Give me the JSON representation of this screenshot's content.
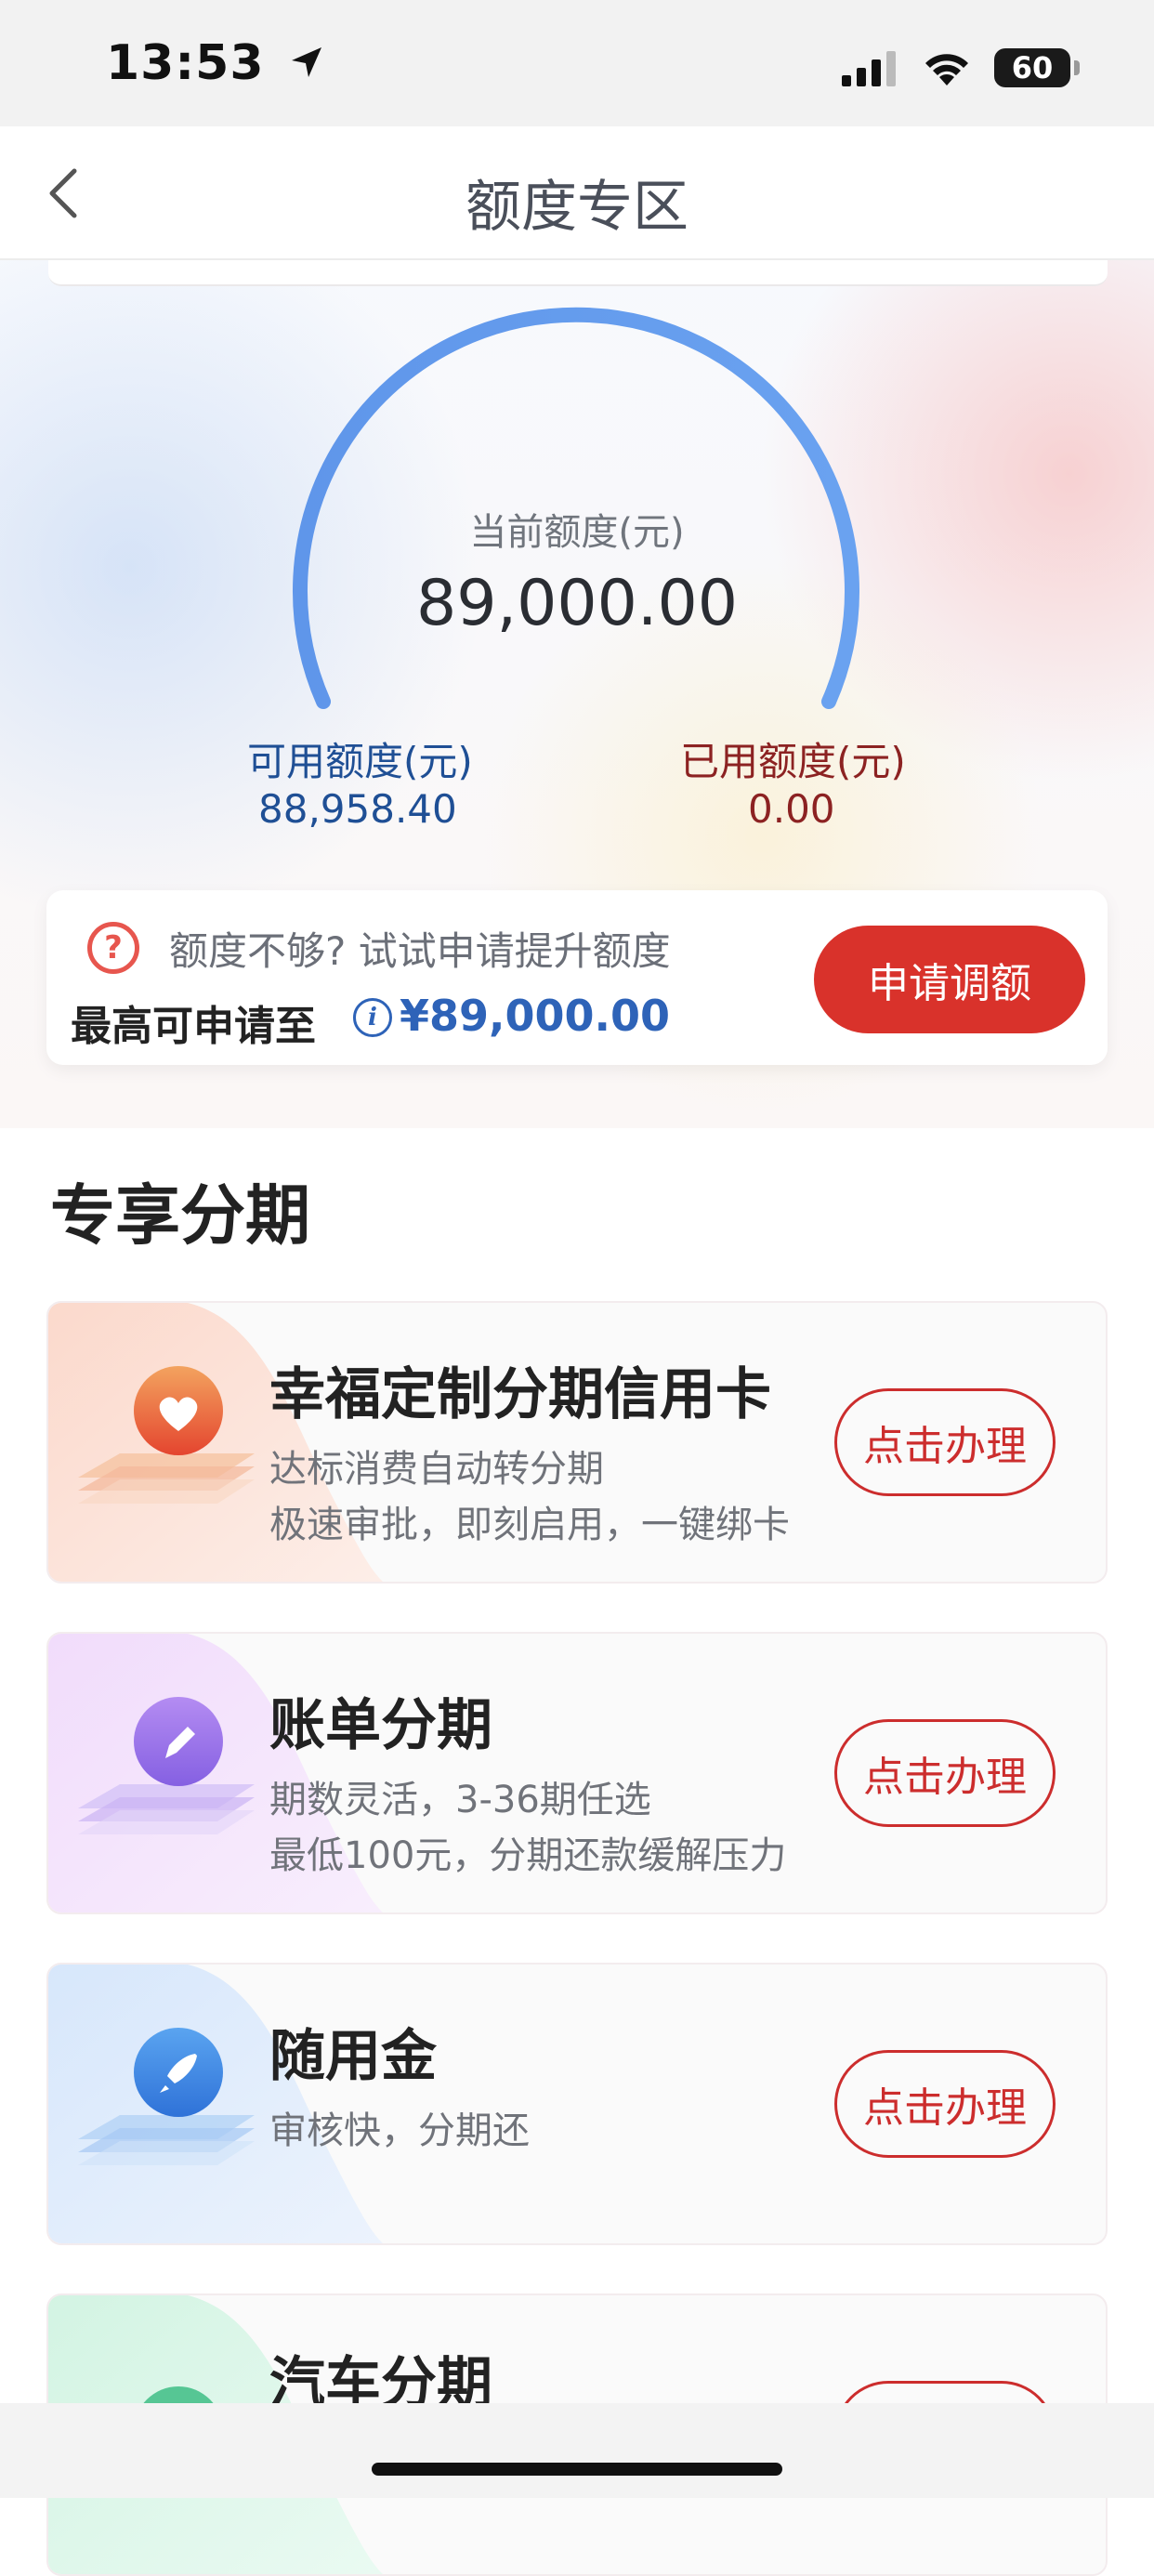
{
  "status": {
    "time": "13:53",
    "battery": "60"
  },
  "nav": {
    "title": "额度专区"
  },
  "limit": {
    "current_label": "当前额度(元)",
    "current_value": "89,000.00",
    "available_label": "可用额度(元)",
    "available_value": "88,958.40",
    "used_label": "已用额度(元)",
    "used_value": "0.00"
  },
  "upgrade": {
    "prompt": "额度不够? 试试申请提升额度",
    "max_label": "最高可申请至",
    "max_value": "¥89,000.00",
    "button": "申请调额"
  },
  "section": {
    "title": "专享分期"
  },
  "products": [
    {
      "title": "幸福定制分期信用卡",
      "desc1": "达标消费自动转分期",
      "desc2": "极速审批，即刻启用，一键绑卡",
      "button": "点击办理",
      "icon": "heart-icon"
    },
    {
      "title": "账单分期",
      "desc1": "期数灵活，3-36期任选",
      "desc2": "最低100元，分期还款缓解压力",
      "button": "点击办理",
      "icon": "pencil-icon"
    },
    {
      "title": "随用金",
      "desc1": "审核快，分期还",
      "button": "点击办理",
      "icon": "rocket-icon"
    },
    {
      "title": "汽车分期",
      "button": "",
      "icon": "car-icon"
    }
  ],
  "colors": {
    "accent_red": "#d9322b",
    "accent_blue": "#2e63b8",
    "gauge_blue": "#5b97ec"
  }
}
